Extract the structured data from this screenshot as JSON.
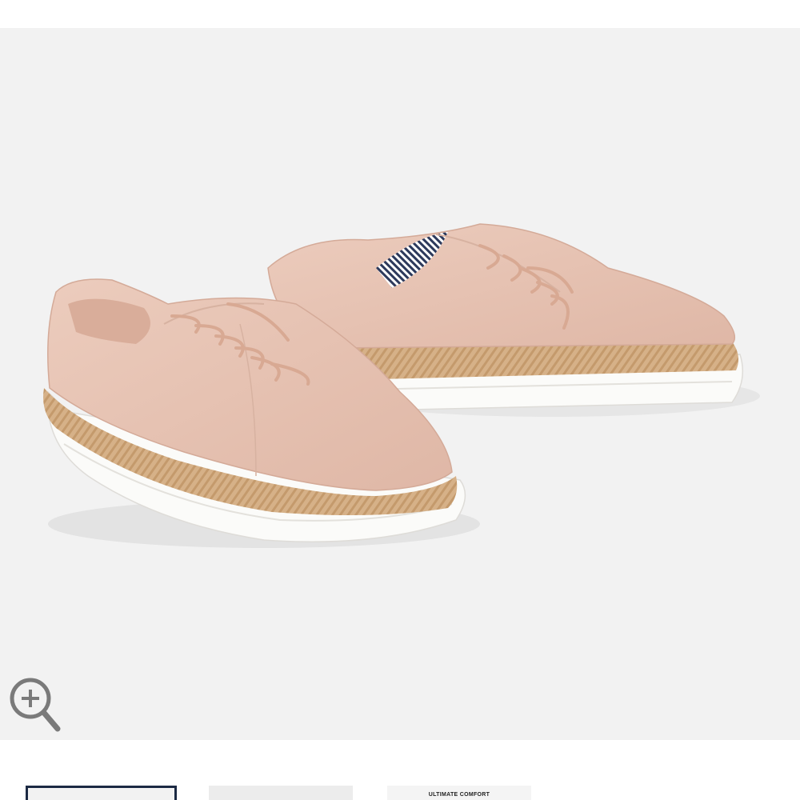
{
  "product": {
    "main_image": {
      "subject": "shoe-pair",
      "colors": {
        "background": "#f2f2f2",
        "suede": "#e7c3b3",
        "jute": "#d4ae83",
        "sole": "#fbfbf9",
        "lining_stripe": "#2d3a5c"
      }
    },
    "zoom_control": {
      "icon": "zoom-in-icon"
    },
    "thumbnails": [
      {
        "selected": true
      },
      {
        "selected": false
      },
      {
        "selected": false,
        "caption": "ULTIMATE COMFORT"
      }
    ],
    "colors": {
      "thumb_selected_border": "#1c2a44",
      "zoom_icon": "#7a7a7a"
    }
  }
}
